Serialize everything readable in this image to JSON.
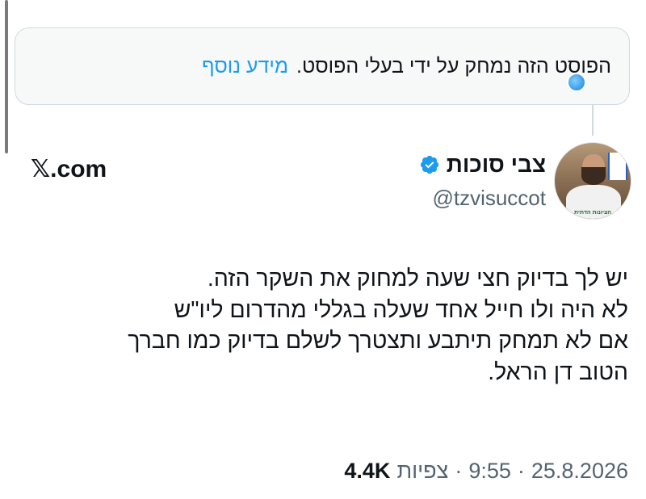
{
  "notice": {
    "text": "הפוסט הזה נמחק על ידי בעלי הפוסט.",
    "link": "מידע נוסף"
  },
  "author": {
    "display_name": "צבי סוכות",
    "handle": "@tzvisuccot",
    "avatar_caption": "הציונות הדתית"
  },
  "brand": "𝕏.com",
  "tweet": {
    "lines": [
      "יש לך בדיוק חצי שעה למחוק את השקר הזה.",
      "לא היה ולו חייל אחד שעלה בגללי מהדרום ליו\"ש",
      "אם לא תמחק תיתבע ותצטרך לשלם בדיוק כמו חברך",
      "הטוב דן הראל."
    ]
  },
  "meta": {
    "date": "25.8.2026",
    "separator": "·",
    "time": "9:55",
    "views_label": "צפיות",
    "views_count": "4.4K"
  },
  "colors": {
    "accent": "#1d9bf0",
    "text": "#0f1419",
    "secondary": "#536471",
    "border": "#cfd9de"
  },
  "icons": [
    "verified-badge-icon",
    "globe-icon"
  ]
}
